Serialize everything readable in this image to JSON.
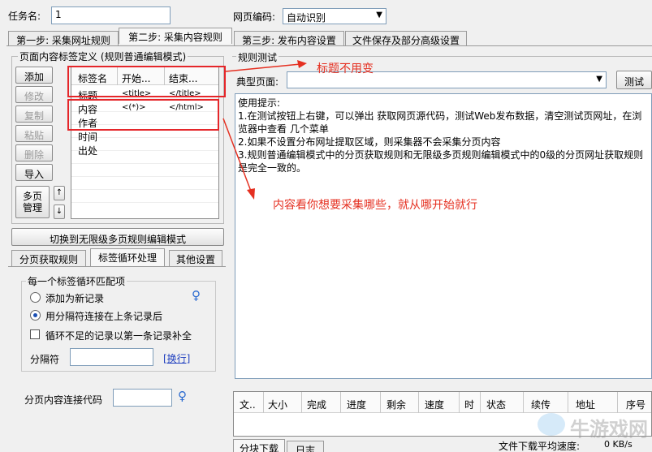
{
  "task": {
    "label": "任务名:",
    "value": "1"
  },
  "encoding": {
    "label": "网页编码:",
    "value": "自动识别"
  },
  "main_tabs": [
    "第一步: 采集网址规则",
    "第二步: 采集内容规则",
    "第三步: 发布内容设置",
    "文件保存及部分高级设置"
  ],
  "tag_section": {
    "title": "页面内容标签定义 (规则普通编辑模式)",
    "buttons": {
      "add": "添加",
      "edit": "修改",
      "copy": "复制",
      "paste": "粘贴",
      "delete": "删除",
      "import": "导入",
      "multipage": "多页\n管理"
    },
    "columns": [
      "标签名",
      "开始...",
      "结束..."
    ],
    "rows": [
      [
        "标题",
        "<title>",
        "</title>"
      ],
      [
        "内容",
        "<(*)>",
        "</html>"
      ],
      [
        "作者",
        "",
        ""
      ],
      [
        "时间",
        "",
        ""
      ],
      [
        "出处",
        "",
        ""
      ]
    ]
  },
  "switch_button": "切换到无限级多页规则编辑模式",
  "sub_tabs": [
    "分页获取规则",
    "标签循环处理",
    "其他设置"
  ],
  "loop_group": {
    "title": "每一个标签循环匹配项",
    "option_new": "添加为新记录",
    "option_append": "用分隔符连接在上条记录后",
    "checkbox_fill": "循环不足的记录以第一条记录补全",
    "separator_label": "分隔符",
    "newline_link": "[换行]"
  },
  "page_link_label": "分页内容连接代码",
  "rule_test": {
    "title": "规则测试",
    "typical_label": "典型页面:",
    "test_button": "测试",
    "tips": [
      "使用提示:",
      "1.在测试按钮上右键，可以弹出 获取网页源代码，测试Web发布数据，清空测试页网址，在浏览器中查看 几个菜单",
      "2.如果不设置分布网址提取区域，则采集器不会采集分页内容",
      "3.规则普通编辑模式中的分页获取规则和无限级多页规则编辑模式中的0级的分页网址获取规则是完全一致的。"
    ]
  },
  "annotations": {
    "title_note": "标题不用变",
    "content_note": "内容看你想要采集哪些，就从哪开始就行"
  },
  "download": {
    "columns": [
      "文..",
      "大小",
      "完成",
      "进度",
      "剩余",
      "速度",
      "时",
      "状态",
      "续传",
      "地址",
      "序号"
    ],
    "tabs": [
      "分块下载",
      "日志"
    ],
    "speed_label": "文件下载平均速度:",
    "speed_value": "0 KB/s"
  },
  "watermark": "牛游戏网",
  "colors": {
    "annotation": "#e53021",
    "link": "#1f3fbf",
    "window_bg": "#f0f0f0"
  }
}
